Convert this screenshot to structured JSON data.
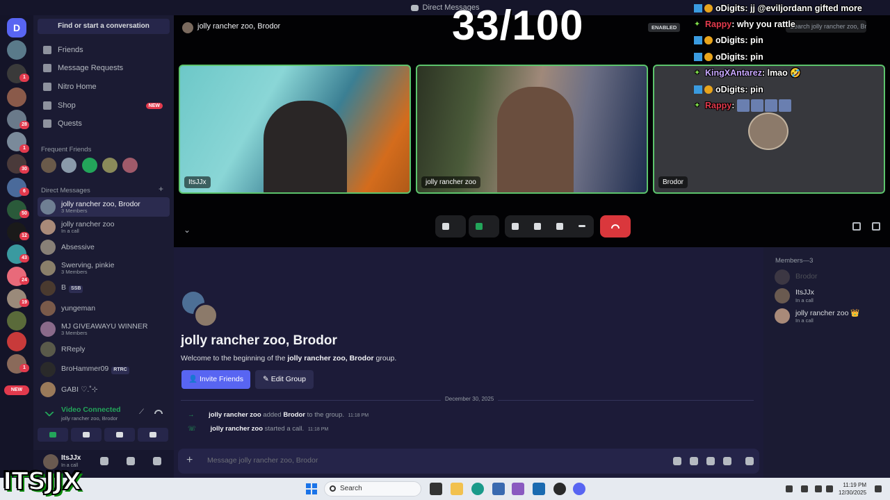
{
  "window": {
    "title": "Direct Messages"
  },
  "sidebar": {
    "find_placeholder": "Find or start a conversation",
    "nav": [
      {
        "label": "Friends",
        "icon": "friends-icon"
      },
      {
        "label": "Message Requests",
        "icon": "mail-icon"
      },
      {
        "label": "Nitro Home",
        "icon": "nitro-icon"
      },
      {
        "label": "Shop",
        "icon": "shop-icon",
        "badge": "NEW"
      },
      {
        "label": "Quests",
        "icon": "quests-icon"
      }
    ],
    "frequent_friends_label": "Frequent Friends",
    "dm_label": "Direct Messages",
    "dms": [
      {
        "name": "jolly rancher zoo, Brodor",
        "sub": "3 Members",
        "color": "#6f7f93"
      },
      {
        "name": "jolly rancher zoo",
        "sub": "In a call",
        "color": "#a98a79"
      },
      {
        "name": "Absessive",
        "sub": "",
        "color": "#888077"
      },
      {
        "name": "Swerving, pinkie",
        "sub": "3 Members",
        "color": "#8a7f6a"
      },
      {
        "name": "B",
        "tag": "SSB",
        "sub": "",
        "color": "#4a3a2f"
      },
      {
        "name": "yungeman",
        "sub": "",
        "color": "#7a5a4a"
      },
      {
        "name": "MJ GIVEAWAYU WINNER",
        "sub": "3 Members",
        "color": "#8a6a8a"
      },
      {
        "name": "RReply",
        "sub": "",
        "color": "#5a5a4a"
      },
      {
        "name": "BroHammer09",
        "tag": "RTRC",
        "sub": "",
        "color": "#2a2a2a"
      },
      {
        "name": "GABI ♡.˚⊹",
        "sub": "",
        "color": "#9a7a5a"
      }
    ],
    "voice": {
      "status": "Video Connected",
      "channel": "jolly rancher zoo, Brodor"
    },
    "user": {
      "name": "ItsJJx",
      "status": "In a call"
    }
  },
  "rail": {
    "badges": [
      "1",
      "1",
      "28",
      "1",
      "30",
      "6",
      "50",
      "12",
      "43",
      "24",
      "19",
      "1"
    ],
    "new_label": "NEW"
  },
  "call": {
    "title": "jolly rancher zoo, Brodor",
    "enabled_label": "ENABLED",
    "search_placeholder": "Search jolly rancher zoo, Brodor",
    "tiles": [
      {
        "name": "ItsJJx"
      },
      {
        "name": "jolly rancher zoo"
      },
      {
        "name": "Brodor"
      }
    ]
  },
  "overlay": {
    "counter": "33/100",
    "chat": [
      {
        "user": "oDigits",
        "msg": "jj @eviljordann gifted more",
        "style": "badges"
      },
      {
        "user": "Rappy",
        "msg": "why you rattle",
        "style": "rappy"
      },
      {
        "user": "oDigits",
        "msg": "pin",
        "style": "badges"
      },
      {
        "user": "oDigits",
        "msg": "pin",
        "style": "badges"
      },
      {
        "user": "KingXAntarez",
        "msg": "lmao 🤣",
        "style": "king"
      },
      {
        "user": "oDigits",
        "msg": "pin",
        "style": "badges"
      },
      {
        "user": "Rappy",
        "msg": "",
        "style": "rappy-emotes"
      }
    ]
  },
  "main": {
    "group_title": "jolly rancher zoo, Brodor",
    "welcome_prefix": "Welcome to the beginning of the",
    "welcome_name": "jolly rancher zoo, Brodor",
    "welcome_suffix": "group.",
    "invite_label": "Invite Friends",
    "edit_label": "Edit Group",
    "date": "December 30, 2025",
    "events": [
      {
        "actor": "jolly rancher zoo",
        "verb": "added",
        "target": "Brodor",
        "rest": "to the group.",
        "time": "11:18 PM"
      },
      {
        "actor": "jolly rancher zoo",
        "verb": "started a call.",
        "target": "",
        "rest": "",
        "time": "11:18 PM"
      }
    ],
    "composer_placeholder": "Message jolly rancher zoo, Brodor"
  },
  "members": {
    "header": "Members—3",
    "list": [
      {
        "name": "Brodor",
        "status": "",
        "dim": true,
        "color": "#8c7a6a"
      },
      {
        "name": "ItsJJx",
        "status": "In a call",
        "dim": false,
        "color": "#6a5a50"
      },
      {
        "name": "jolly rancher zoo 👑",
        "status": "In a call",
        "dim": false,
        "color": "#a98a79"
      }
    ]
  },
  "taskbar": {
    "search_placeholder": "Search",
    "time": "11:19 PM",
    "date": "12/30/2025"
  },
  "logo_text": "ITSJJX",
  "colors": {
    "accent": "#5865f2",
    "online": "#23a55a",
    "danger": "#da373c",
    "background": "#1c1b38"
  }
}
